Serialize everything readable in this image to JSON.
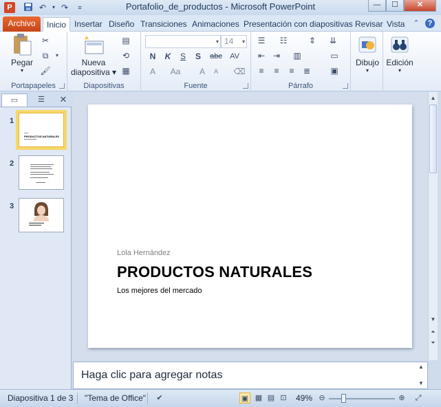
{
  "window": {
    "title": "Portafolio_de_productos  -  Microsoft PowerPoint",
    "app_icon_letter": "P",
    "controls": {
      "minimize": "—",
      "maximize": "☐",
      "close": "✕"
    }
  },
  "tabs": {
    "archivo": "Archivo",
    "items": [
      "Inicio",
      "Insertar",
      "Diseño",
      "Transiciones",
      "Animaciones",
      "Presentación con diapositivas",
      "Revisar",
      "Vista"
    ]
  },
  "ribbon": {
    "portapapeles": {
      "label": "Portapapeles",
      "paste": "Pegar"
    },
    "diapositivas": {
      "label": "Diapositivas",
      "new_slide_line1": "Nueva",
      "new_slide_line2": "diapositiva ▾"
    },
    "fuente": {
      "label": "Fuente",
      "size_value": "14",
      "buttons": [
        "N",
        "K",
        "S",
        "S",
        "abc",
        "AV"
      ]
    },
    "parrafo": {
      "label": "Párrafo"
    },
    "dibujo": {
      "label": "Dibujo"
    },
    "edicion": {
      "label": "Edición"
    }
  },
  "thumbnails": [
    {
      "num": "1",
      "selected": true,
      "title": "PRODUCTOS NATURALES"
    },
    {
      "num": "2",
      "selected": false
    },
    {
      "num": "3",
      "selected": false
    }
  ],
  "slide": {
    "author": "Lola Hernández",
    "title": "PRODUCTOS NATURALES",
    "subtitle": "Los mejores del mercado"
  },
  "notes": {
    "placeholder": "Haga clic para agregar notas"
  },
  "status": {
    "slide_info": "Diapositiva 1 de 3",
    "theme": "\"Tema de Office\"",
    "zoom": "49%"
  },
  "colors": {
    "archivo_tab": "#d24726",
    "selected_thumb": "#f7d76a",
    "ribbon_bg": "#dce7f5"
  }
}
